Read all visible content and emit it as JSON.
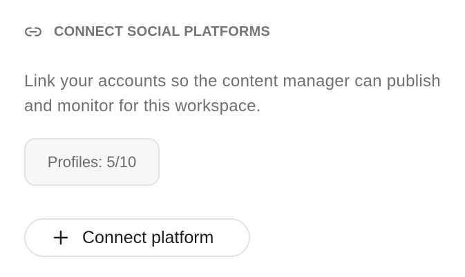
{
  "section": {
    "icon": "link-icon",
    "title": "CONNECT SOCIAL PLATFORMS",
    "description": "Link your accounts so the content manager can publish and monitor for this workspace."
  },
  "profiles": {
    "label": "Profiles: 5/10",
    "used": 5,
    "limit": 10
  },
  "connect_button": {
    "icon": "plus-icon",
    "label": "Connect platform"
  },
  "colors": {
    "title": "#74747a",
    "text": "#6f6f74",
    "badge_bg": "#f7f7f5",
    "badge_border": "#e4e4e1",
    "button_border": "#e3e3e3",
    "button_text": "#1c1c1e"
  }
}
